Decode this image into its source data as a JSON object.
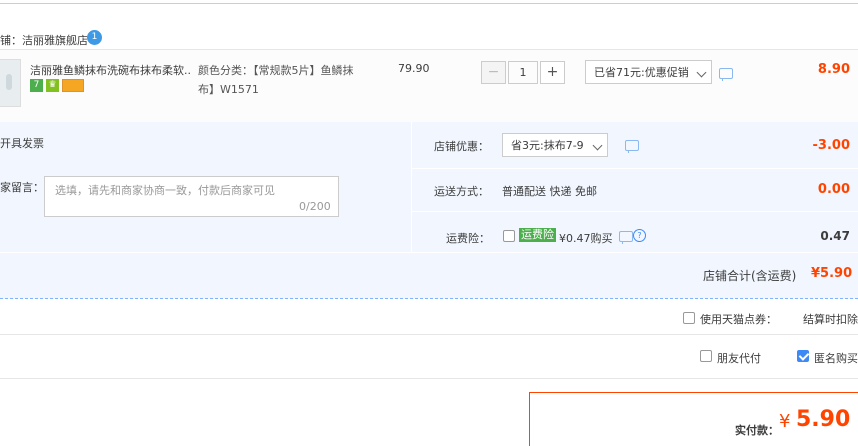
{
  "shop": {
    "name": "铺：洁丽雅旗舰店",
    "wangwang_icon": "1"
  },
  "item": {
    "title": "洁丽雅鱼鳞抹布洗碗布抹布柔软...",
    "badges": [
      "7",
      "♛",
      ""
    ],
    "sku_line1": "颜色分类：【常规款5片】鱼鳞抹",
    "sku_line2": "布】W1571",
    "unit_price": "79.90",
    "quantity": "1",
    "qty_minus": "−",
    "qty_plus": "+",
    "promo": "已省71元:优惠促销",
    "subtotal": "8.90"
  },
  "invoice_label": "开具发票",
  "memo": {
    "label": "家留言：",
    "placeholder": "选填，请先和商家协商一致，付款后商家可见",
    "count": "0/200"
  },
  "shop_discount": {
    "label": "店铺优惠：",
    "selected": "省3元:抹布7-9",
    "value": "-3.00"
  },
  "shipping": {
    "label": "运送方式：",
    "method": "普通配送 快递 免邮",
    "value": "0.00"
  },
  "insurance": {
    "label": "运费险：",
    "tag": "运费险",
    "price": "¥0.47购买",
    "value": "0.47",
    "help": "?"
  },
  "shop_total": {
    "label": "店铺合计(含运费)",
    "value": "¥5.90"
  },
  "tmall_points": {
    "label": "使用天猫点券：",
    "note": "结算时扣除"
  },
  "friend_pay": {
    "label": "朋友代付"
  },
  "anonymous": {
    "label": "匿名购买"
  },
  "real_pay": {
    "label": "实付款：",
    "currency": "¥",
    "value": "5.90"
  },
  "colors": {
    "accent": "#ff4400",
    "link": "#3d8af7",
    "panel": "#f2f7ff"
  }
}
